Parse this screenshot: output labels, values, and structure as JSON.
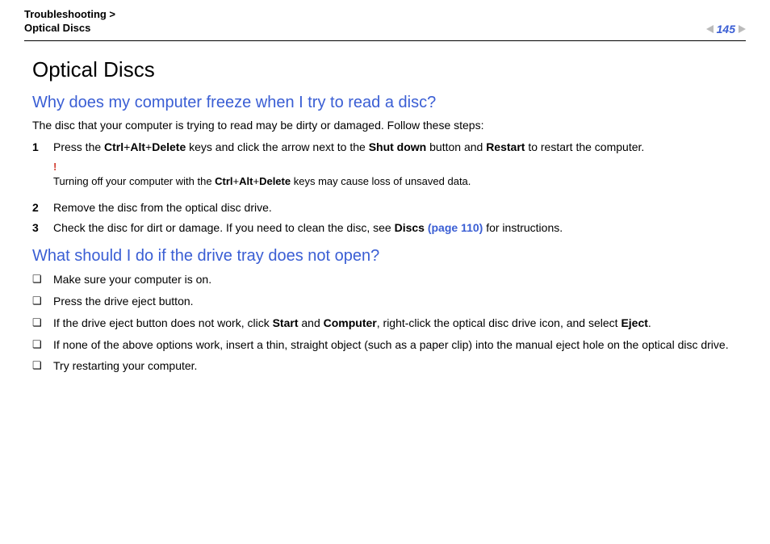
{
  "header": {
    "breadcrumb_line1": "Troubleshooting >",
    "breadcrumb_line2": "Optical Discs",
    "page_number": "145"
  },
  "title": "Optical Discs",
  "section1": {
    "heading": "Why does my computer freeze when I try to read a disc?",
    "intro": "The disc that your computer is trying to read may be dirty or damaged. Follow these steps:",
    "step1_num": "1",
    "step1_a": "Press the ",
    "step1_b": "Ctrl",
    "step1_c": "+",
    "step1_d": "Alt",
    "step1_e": "+",
    "step1_f": "Delete",
    "step1_g": " keys and click the arrow next to the ",
    "step1_h": "Shut down",
    "step1_i": " button and ",
    "step1_j": "Restart",
    "step1_k": " to restart the computer.",
    "warn_bang": "!",
    "warn_a": "Turning off your computer with the ",
    "warn_b": "Ctrl",
    "warn_c": "+",
    "warn_d": "Alt",
    "warn_e": "+",
    "warn_f": "Delete",
    "warn_g": " keys may cause loss of unsaved data.",
    "step2_num": "2",
    "step2": "Remove the disc from the optical disc drive.",
    "step3_num": "3",
    "step3_a": "Check the disc for dirt or damage. If you need to clean the disc, see ",
    "step3_b": "Discs ",
    "step3_link": "(page 110)",
    "step3_c": " for instructions."
  },
  "section2": {
    "heading": "What should I do if the drive tray does not open?",
    "b1": "Make sure your computer is on.",
    "b2": "Press the drive eject button.",
    "b3_a": "If the drive eject button does not work, click ",
    "b3_b": "Start",
    "b3_c": " and ",
    "b3_d": "Computer",
    "b3_e": ", right-click the optical disc drive icon, and select ",
    "b3_f": "Eject",
    "b3_g": ".",
    "b4": "If none of the above options work, insert a thin, straight object (such as a paper clip) into the manual eject hole on the optical disc drive.",
    "b5": "Try restarting your computer."
  },
  "bullet": "❏"
}
